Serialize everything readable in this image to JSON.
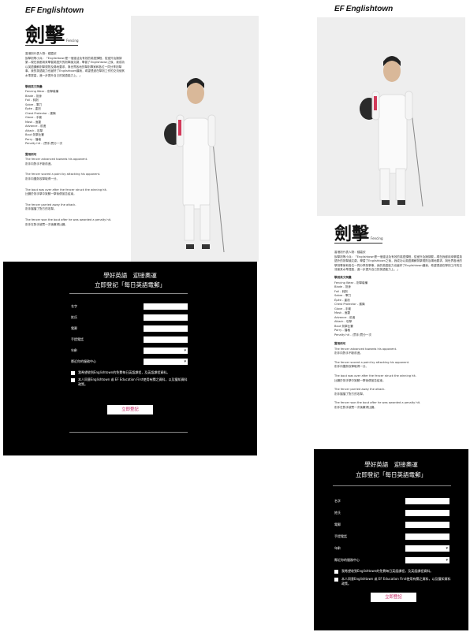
{
  "brand": {
    "ef": "EF",
    "name": "Englishtown"
  },
  "article": {
    "title_cn": "劍擊",
    "title_en": "Fencing",
    "intro": "香港劍代表人物：鍾嘉欣\n說擊劍等小兵：「Englishtown是一個靈活及有效的英語課程，從室外及擁擠繁…現在我都用來學習英語外的劍擊論文劇，學習了Englishtown之後，我成功以英語講解劍擊規則及場地要求，與世界各地的擊劍專家和各位一同分享劍擊事，我的英語能力也變好了Englishtown讓我，希望透過在擊劍工作的交流使其水準提高，進一步提升自己的英語能力上。」",
    "vocab_heading": "擊劍英文詞彙",
    "vocab": [
      "Fencing Wear - 劍擊裝備",
      "Blade - 劍身",
      "Foil - 鈍劍",
      "Sabre - 軍刀",
      "Épée - 重劍",
      "Chest Protector - 護胸",
      "Glove - 手套",
      "Mask - 面罩",
      "Advance - 前進",
      "Attack - 攻擊",
      "Bout 劍擊比賽",
      "Parry - 擋格",
      "Penalty hit - (罰手)罰分一次"
    ],
    "examples_heading": "實用例句",
    "examples": [
      {
        "en": "The fencer advanced towards his opponent.",
        "cn": "劍手向對手不斷前進。"
      },
      {
        "en": "The fencer scored a point by attacking his opponent.",
        "cn": "劍手向攤劍攻擊取得一分。"
      },
      {
        "en": "The bout was over after the fencer struck the winning hit.",
        "cn": "比賽於劍手擊中致勝一擊後便宣告結束。"
      },
      {
        "en": "The fencer parried away the attack.",
        "cn": "劍手擋擋了對方的攻擊。"
      },
      {
        "en": "The fencer won the bout after he was awarded a penalty hit.",
        "cn": "劍手在對手被罰一次後贏得比賽。"
      }
    ]
  },
  "form": {
    "headline_1": "學好英語　迎接奧運",
    "headline_2": "立即登記「每日英語電郵」",
    "fields": [
      {
        "label": "名字",
        "type": "text"
      },
      {
        "label": "姓氏",
        "type": "text"
      },
      {
        "label": "電郵",
        "type": "text"
      },
      {
        "label": "手提電話",
        "type": "text"
      },
      {
        "label": "年齡",
        "type": "select"
      },
      {
        "label": "鄰近你的服務中心",
        "type": "select"
      }
    ],
    "consent_1": "我希望收到Englishtown的免費每日英語課程，及英語課程資料。",
    "consent_2": "本人同意Englishtown 或 EF Education First使用有關之資料，以及獲知資料政策。",
    "submit": "立即登記"
  }
}
